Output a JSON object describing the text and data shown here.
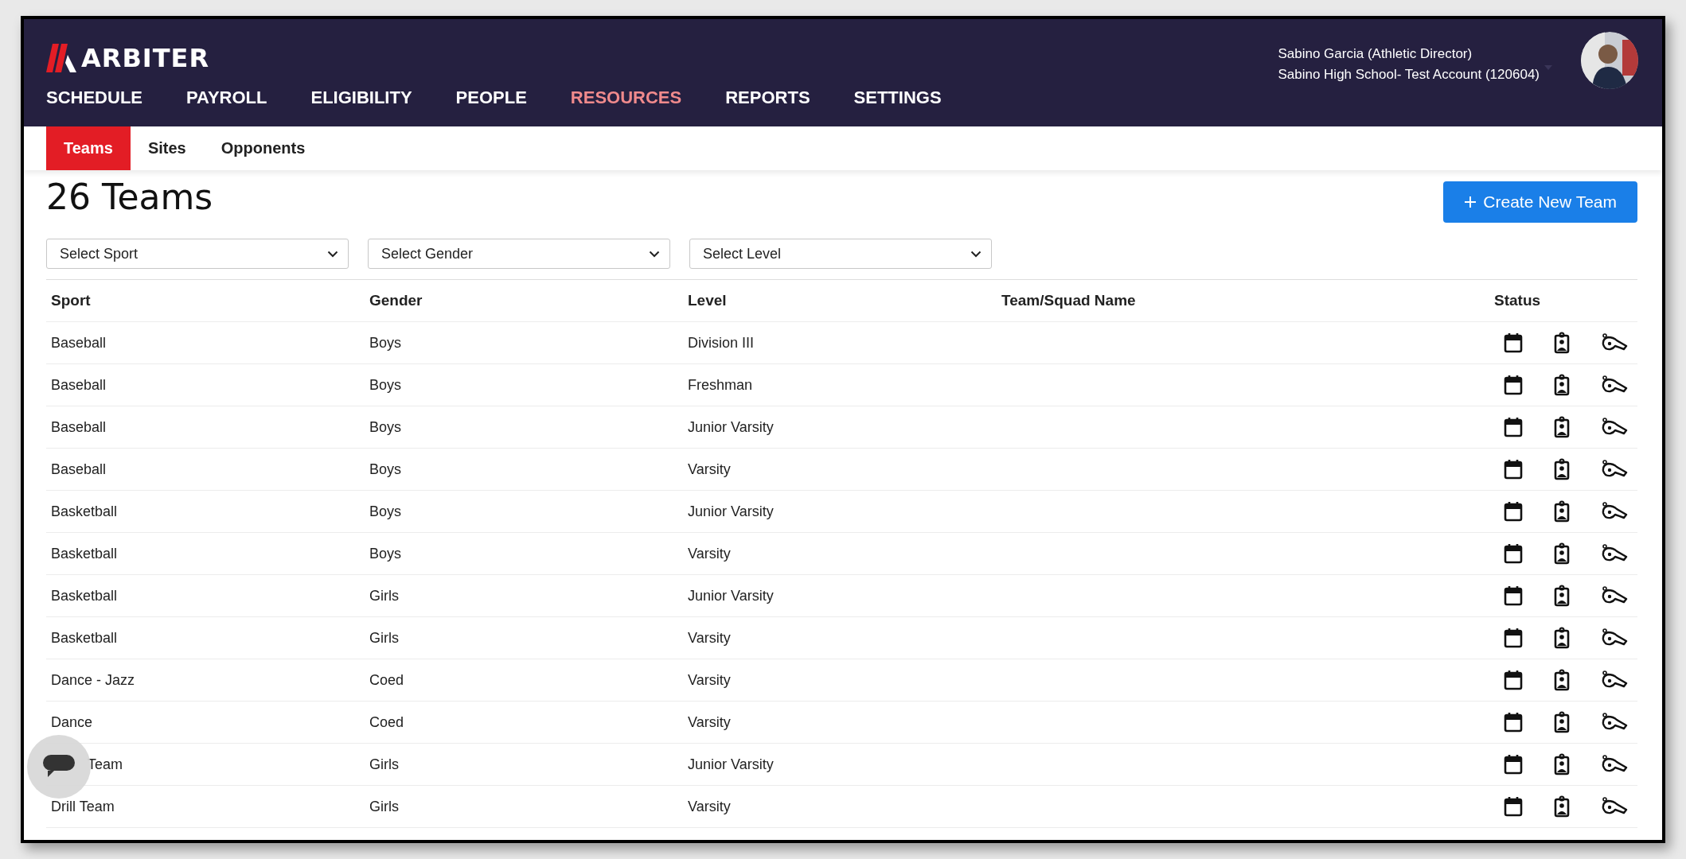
{
  "header": {
    "logo": "ARBITER",
    "nav": [
      {
        "label": "SCHEDULE",
        "selected": false
      },
      {
        "label": "PAYROLL",
        "selected": false
      },
      {
        "label": "ELIGIBILITY",
        "selected": false
      },
      {
        "label": "PEOPLE",
        "selected": false
      },
      {
        "label": "RESOURCES",
        "selected": true
      },
      {
        "label": "REPORTS",
        "selected": false
      },
      {
        "label": "SETTINGS",
        "selected": false
      }
    ],
    "user": {
      "name": "Sabino Garcia (Athletic Director)",
      "account": "Sabino High School- Test Account (120604)"
    }
  },
  "subnav": [
    {
      "label": "Teams",
      "selected": true
    },
    {
      "label": "Sites",
      "selected": false
    },
    {
      "label": "Opponents",
      "selected": false
    }
  ],
  "title": "26 Teams",
  "create_button": "Create New Team",
  "filters": [
    {
      "placeholder": "Select Sport"
    },
    {
      "placeholder": "Select Gender"
    },
    {
      "placeholder": "Select Level"
    }
  ],
  "table": {
    "columns": [
      "Sport",
      "Gender",
      "Level",
      "Team/Squad Name",
      "Status"
    ],
    "rows": [
      {
        "sport": "Baseball",
        "gender": "Boys",
        "level": "Division III"
      },
      {
        "sport": "Baseball",
        "gender": "Boys",
        "level": "Freshman"
      },
      {
        "sport": "Baseball",
        "gender": "Boys",
        "level": "Junior Varsity"
      },
      {
        "sport": "Baseball",
        "gender": "Boys",
        "level": "Varsity"
      },
      {
        "sport": "Basketball",
        "gender": "Boys",
        "level": "Junior Varsity"
      },
      {
        "sport": "Basketball",
        "gender": "Boys",
        "level": "Varsity"
      },
      {
        "sport": "Basketball",
        "gender": "Girls",
        "level": "Junior Varsity"
      },
      {
        "sport": "Basketball",
        "gender": "Girls",
        "level": "Varsity"
      },
      {
        "sport": "Dance - Jazz",
        "gender": "Coed",
        "level": "Varsity"
      },
      {
        "sport": "Dance",
        "gender": "Coed",
        "level": "Varsity"
      },
      {
        "sport": "Team",
        "gender": "Girls",
        "level": "Junior Varsity",
        "partly_hidden": true
      },
      {
        "sport": "Drill Team",
        "gender": "Girls",
        "level": "Varsity"
      }
    ]
  }
}
